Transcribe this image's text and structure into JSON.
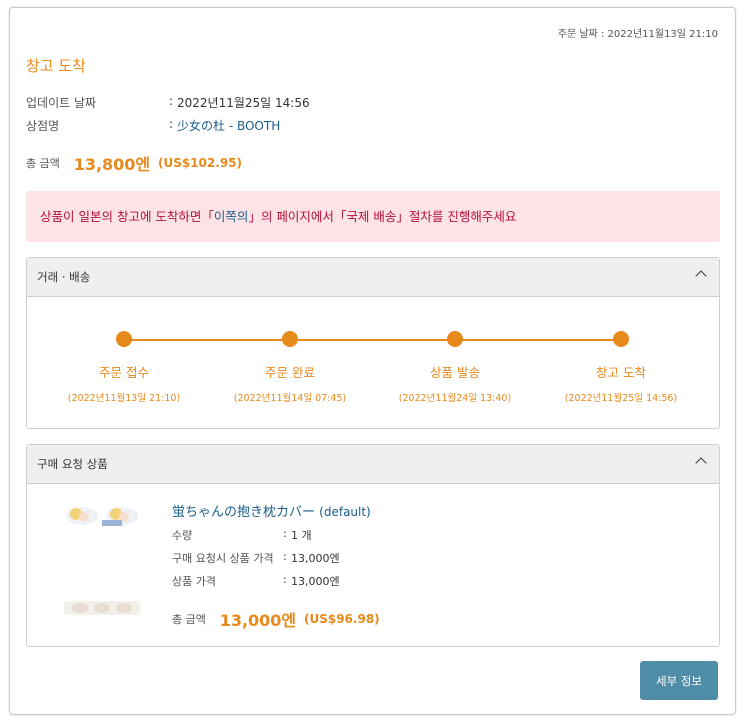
{
  "header": {
    "order_date_label": "주문 날짜",
    "order_date_value": "2022년11월13일 21:10"
  },
  "status_title": "창고 도착",
  "info": {
    "updated_label": "업데이트 날짜",
    "updated_value": "2022년11월25일 14:56",
    "shop_label": "상점명",
    "shop_value": "少女の杜 - BOOTH"
  },
  "total": {
    "label": "총 금액",
    "yen": "13,800엔",
    "usd": "(US$102.95)"
  },
  "alert": {
    "before": "상품이 일본의 창고에 도착하면「",
    "highlight": "이쪽의",
    "after": "」의 페이지에서「국제 배송」절차를 진행해주세요"
  },
  "shipping_panel": {
    "title": "거래 · 배송",
    "steps": [
      {
        "name": "주문 접수",
        "when": "(2022년11월13일 21:10)"
      },
      {
        "name": "주문 완료",
        "when": "(2022년11월14일 07:45)"
      },
      {
        "name": "상품 발송",
        "when": "(2022년11월24일 13:40)"
      },
      {
        "name": "창고 도착",
        "when": "(2022년11월25일 14:56)"
      }
    ]
  },
  "product_panel": {
    "title": "구매 요청 상품",
    "product_name": "蛍ちゃんの抱き枕カバー",
    "variant": "(default)",
    "qty_label": "수량",
    "qty_value": "1 개",
    "req_price_label": "구매 요청시 상품 가격",
    "req_price_value": "13,000엔",
    "price_label": "상품 가격",
    "price_value": "13,000엔",
    "total_label": "총 금액",
    "total_yen": "13,000엔",
    "total_usd": "(US$96.98)"
  },
  "detail_button": "세부 정보",
  "colors": {
    "accent": "#e8891c",
    "link": "#1a5e8a",
    "alert_bg": "#fde2e6",
    "alert_text": "#b3123a",
    "button": "#4f8ca8"
  }
}
